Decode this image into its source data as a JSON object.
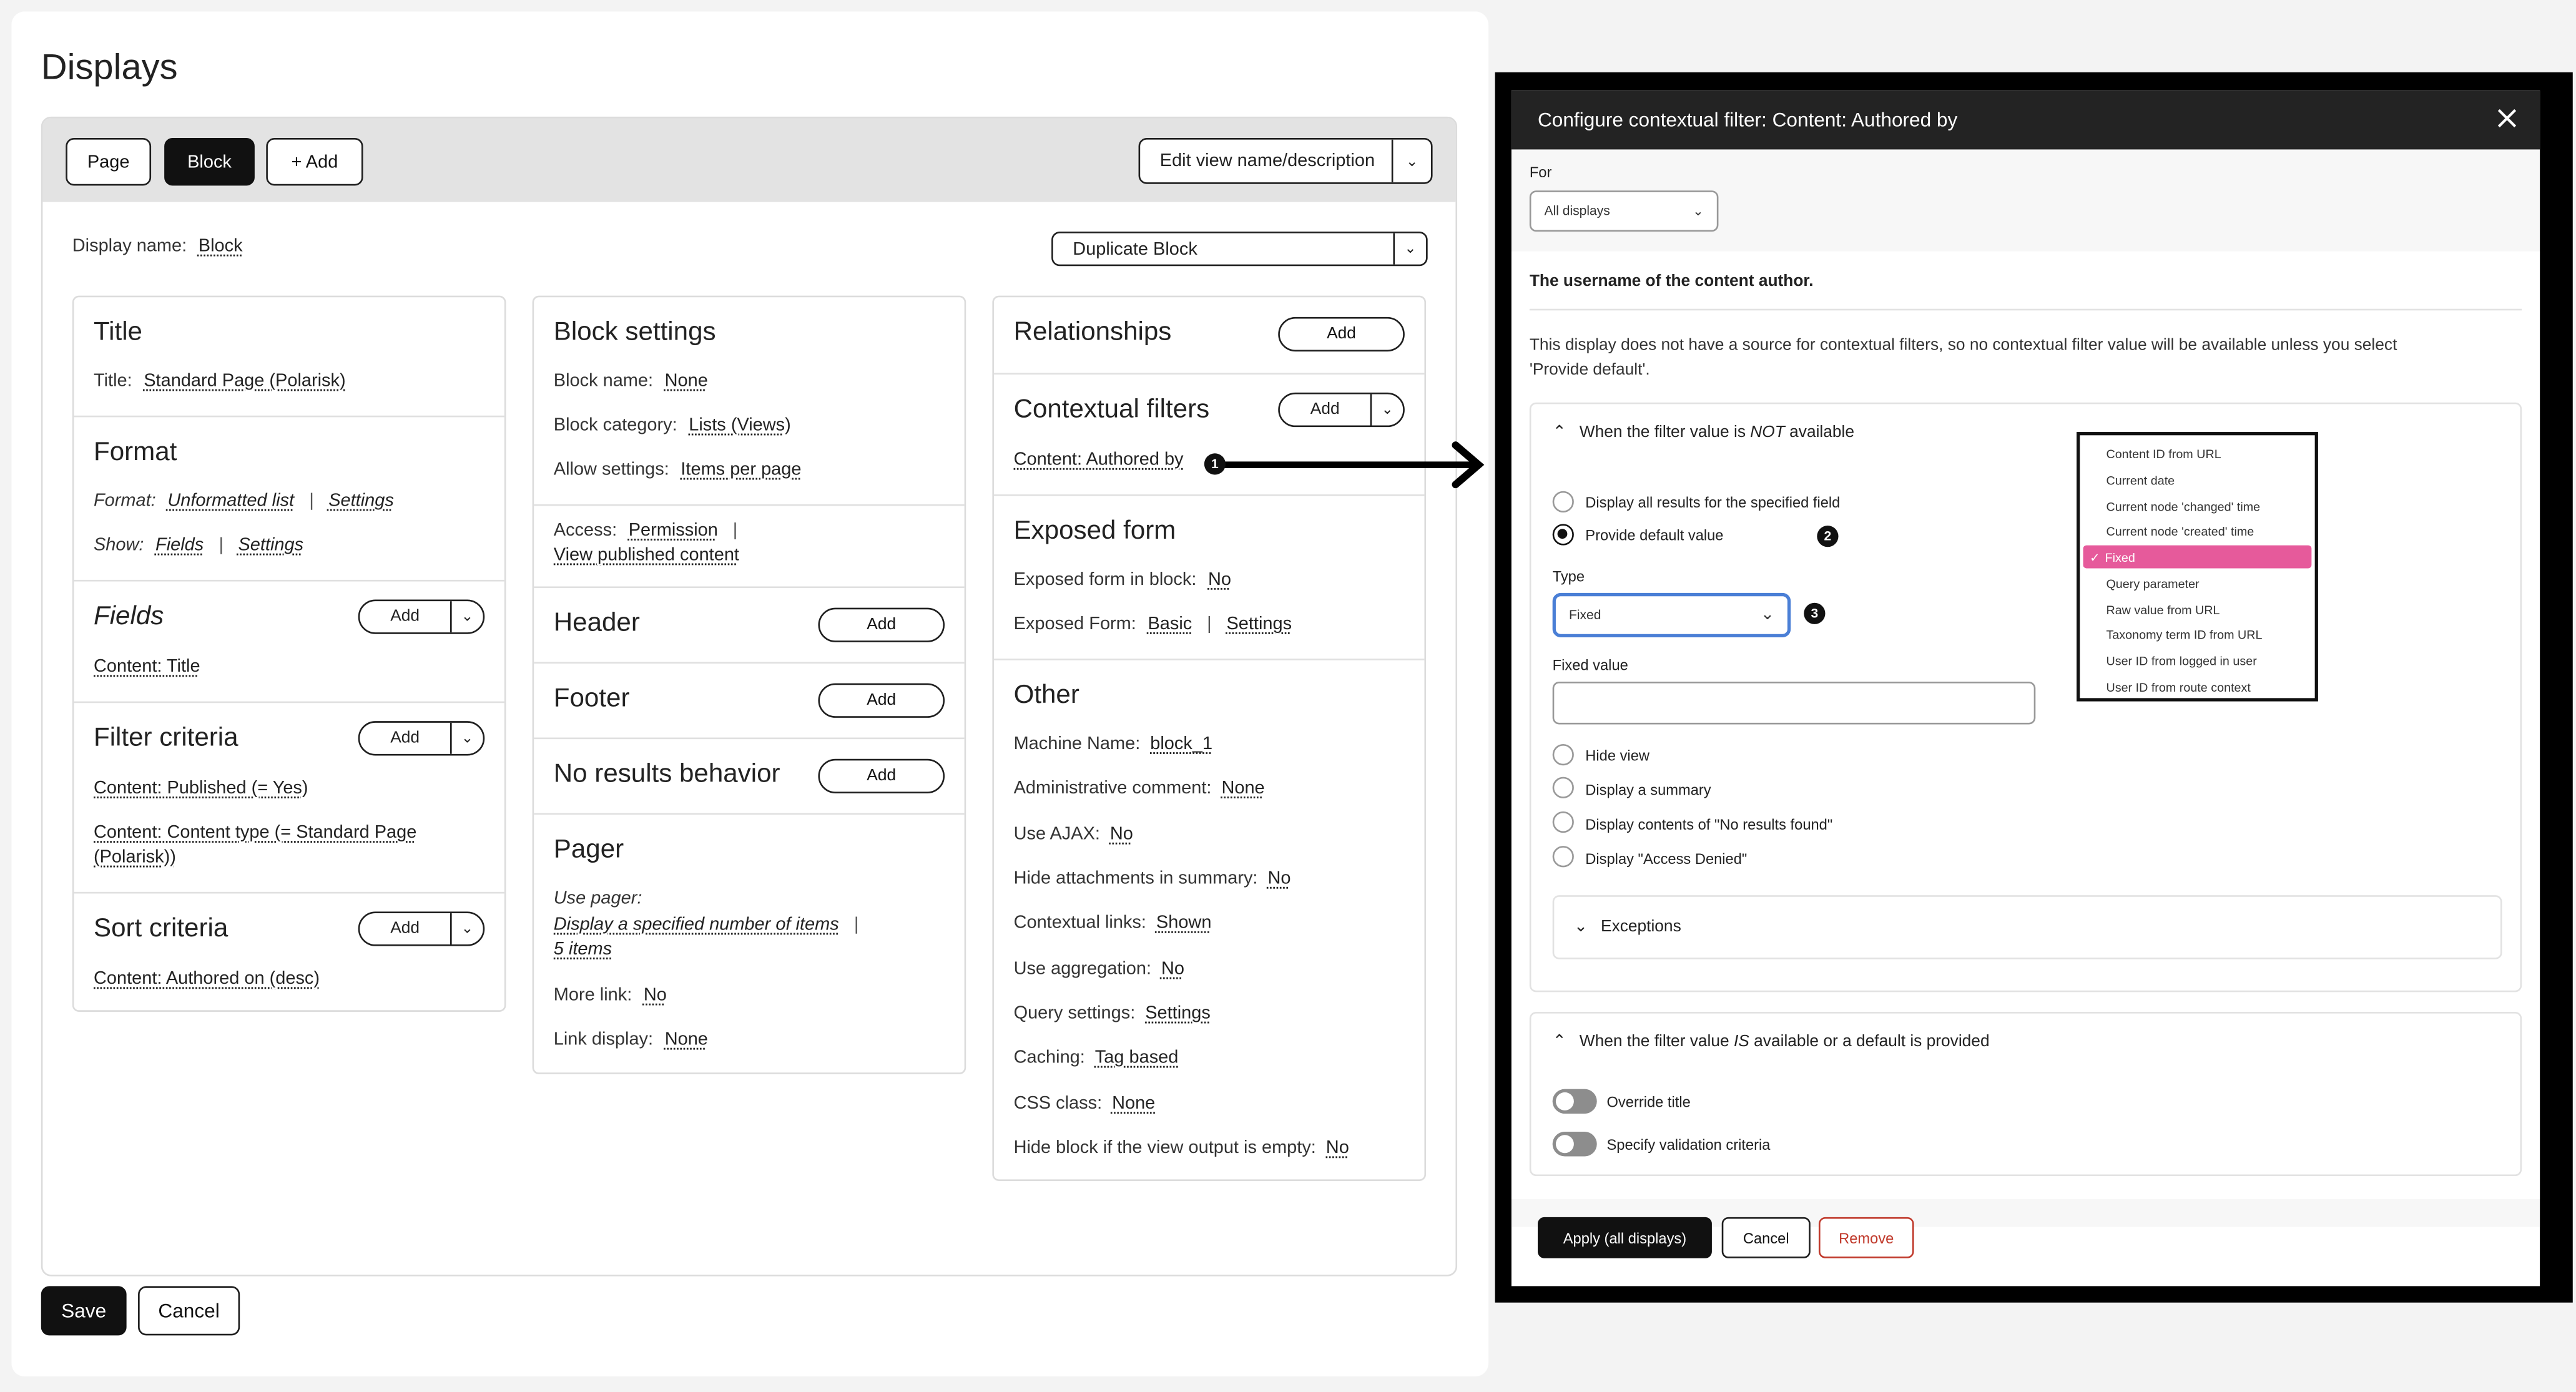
{
  "page": {
    "title": "Displays"
  },
  "toolbar": {
    "tabs": [
      "Page",
      "Block"
    ],
    "add_label": "+ Add",
    "edit_label": "Edit view name/description"
  },
  "display": {
    "name_label": "Display name:",
    "name_value": "Block",
    "duplicate_label": "Duplicate Block"
  },
  "col1": {
    "title": {
      "heading": "Title",
      "label": "Title:",
      "value": "Standard Page (Polarisk)"
    },
    "format": {
      "heading": "Format",
      "format_label": "Format:",
      "format_value": "Unformatted list",
      "settings": "Settings",
      "show_label": "Show:",
      "show_value": "Fields",
      "show_settings": "Settings"
    },
    "fields": {
      "heading": "Fields",
      "add": "Add",
      "items": [
        "Content: Title"
      ]
    },
    "filter": {
      "heading": "Filter criteria",
      "add": "Add",
      "items": [
        "Content: Published (= Yes)",
        "Content: Content type (= Standard Page",
        "(Polarisk))"
      ]
    },
    "sort": {
      "heading": "Sort criteria",
      "add": "Add",
      "items": [
        "Content: Authored on (desc)"
      ]
    }
  },
  "col2": {
    "block": {
      "heading": "Block settings",
      "name_label": "Block name:",
      "name_value": "None",
      "category_label": "Block category:",
      "category_value": "Lists (Views)",
      "allow_label": "Allow settings:",
      "allow_value": "Items per page"
    },
    "access": {
      "label": "Access:",
      "value": "Permission",
      "value2": "View published content"
    },
    "header": {
      "heading": "Header",
      "add": "Add"
    },
    "footer": {
      "heading": "Footer",
      "add": "Add"
    },
    "noresults": {
      "heading": "No results behavior",
      "add": "Add"
    },
    "pager": {
      "heading": "Pager",
      "use_label": "Use pager:",
      "use_value": "Display a specified number of items",
      "items_value": "5 items",
      "more_label": "More link:",
      "more_value": "No",
      "link_label": "Link display:",
      "link_value": "None"
    }
  },
  "col3": {
    "relationships": {
      "heading": "Relationships",
      "add": "Add"
    },
    "contextual": {
      "heading": "Contextual filters",
      "add": "Add",
      "item": "Content: Authored by"
    },
    "exposed": {
      "heading": "Exposed form",
      "inblock_label": "Exposed form in block:",
      "inblock_value": "No",
      "form_label": "Exposed Form:",
      "form_value": "Basic",
      "form_settings": "Settings"
    },
    "other": {
      "heading": "Other",
      "rows": [
        {
          "label": "Machine Name:",
          "value": "block_1"
        },
        {
          "label": "Administrative comment:",
          "value": "None"
        },
        {
          "label": "Use AJAX:",
          "value": "No"
        },
        {
          "label": "Hide attachments in summary:",
          "value": "No"
        },
        {
          "label": "Contextual links:",
          "value": "Shown"
        },
        {
          "label": "Use aggregation:",
          "value": "No"
        },
        {
          "label": "Query settings:",
          "value": "Settings"
        },
        {
          "label": "Caching:",
          "value": "Tag based"
        },
        {
          "label": "CSS class:",
          "value": "None"
        },
        {
          "label": "Hide block if the view output is empty:",
          "value": "No"
        }
      ]
    }
  },
  "footer": {
    "save": "Save",
    "cancel": "Cancel"
  },
  "modal": {
    "title": "Configure contextual filter: Content: Authored by",
    "for_label": "For",
    "for_value": "All displays",
    "description": "The username of the content author.",
    "notice_line1": "This display does not have a source for contextual filters, so no contextual filter value will be available unless you select",
    "notice_line2": "'Provide default'.",
    "not_available": {
      "prefix": "When the filter value is ",
      "em": "NOT",
      "suffix": " available"
    },
    "radio_all": "Display all results for the specified field",
    "radio_default": "Provide default value",
    "type_label": "Type",
    "type_value": "Fixed",
    "fixed_label": "Fixed value",
    "fixed_value": "",
    "radios": [
      "Hide view",
      "Display a summary",
      "Display contents of \"No results found\"",
      "Display \"Access Denied\""
    ],
    "exceptions": "Exceptions",
    "is_available": {
      "prefix": "When the filter value ",
      "em": "IS",
      "suffix": " available or a default is provided"
    },
    "override_title": "Override title",
    "validation": "Specify validation criteria",
    "apply": "Apply (all displays)",
    "cancel": "Cancel",
    "remove": "Remove"
  },
  "dropdown": {
    "options": [
      "Content ID from URL",
      "Current date",
      "Current node 'changed' time",
      "Current node 'created' time",
      "Fixed",
      "Query parameter",
      "Raw value from URL",
      "Taxonomy term ID from URL",
      "User ID from logged in user",
      "User ID from route context"
    ],
    "selected": "Fixed",
    "check": "✓"
  },
  "markers": [
    "1",
    "2",
    "3"
  ],
  "colors": {
    "selected_option": "#e65a9b",
    "remove": "#c0392b",
    "focus": "#4a7fd6"
  }
}
